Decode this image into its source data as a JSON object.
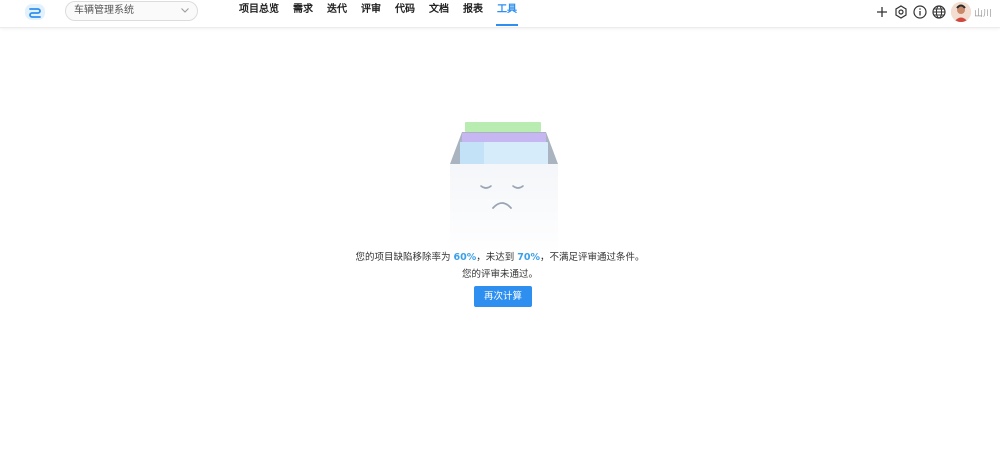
{
  "header": {
    "project_select": {
      "value": "车辆管理系统"
    },
    "nav": [
      {
        "label": "项目总览",
        "active": false
      },
      {
        "label": "需求",
        "active": false
      },
      {
        "label": "迭代",
        "active": false
      },
      {
        "label": "评审",
        "active": false
      },
      {
        "label": "代码",
        "active": false
      },
      {
        "label": "文档",
        "active": false
      },
      {
        "label": "报表",
        "active": false
      },
      {
        "label": "工具",
        "active": true
      }
    ],
    "tools": [
      "plus-icon",
      "settings-icon",
      "info-icon",
      "globe-icon"
    ],
    "user": {
      "name": "山川"
    }
  },
  "result": {
    "line1_prefix": "您的项目缺陷移除率为 ",
    "actual_rate": "60%",
    "line1_middle": "，未达到 ",
    "target_rate": "70%",
    "line1_suffix": "，不满足评审通过条件。",
    "line2": "您的评审未通过。",
    "button_label": "再次计算"
  },
  "colors": {
    "accent": "#2e8ff0",
    "highlight": "#3aa0e8"
  }
}
